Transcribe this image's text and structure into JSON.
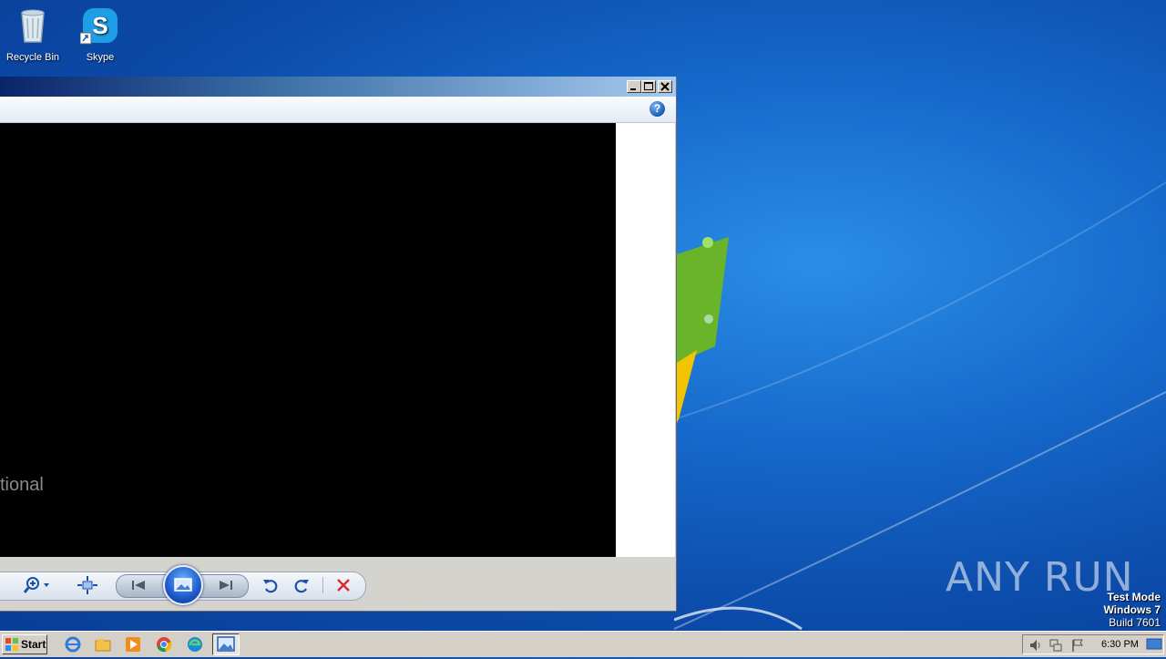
{
  "desktop": {
    "icons": [
      {
        "label": "Recycle Bin"
      },
      {
        "label": "Skype"
      }
    ]
  },
  "window": {
    "image_text": "tional",
    "help_label": "?"
  },
  "watermark": {
    "brand": "ANY RUN",
    "test_mode": "Test Mode",
    "os": "Windows 7",
    "build": "Build 7601"
  },
  "taskbar": {
    "start_label": "Start",
    "clock": "6:30 PM"
  },
  "colors": {
    "desktop_bg": "#1566c8",
    "taskbar_bg": "#d4d0c8",
    "close_x": "#d92b2b"
  }
}
